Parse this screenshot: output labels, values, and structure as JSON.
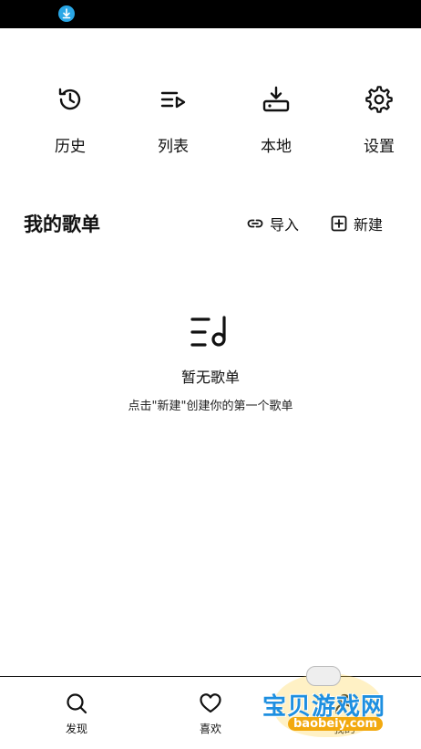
{
  "quick_actions": [
    {
      "label": "历史",
      "icon": "history-icon"
    },
    {
      "label": "列表",
      "icon": "playlist-icon"
    },
    {
      "label": "本地",
      "icon": "local-download-icon"
    },
    {
      "label": "设置",
      "icon": "gear-icon"
    }
  ],
  "playlists": {
    "title": "我的歌单",
    "import_label": "导入",
    "new_label": "新建"
  },
  "empty_state": {
    "title": "暂无歌单",
    "hint": "点击\"新建\"创建你的第一个歌单"
  },
  "tabs": [
    {
      "label": "发现",
      "icon": "search-icon"
    },
    {
      "label": "喜欢",
      "icon": "heart-icon"
    },
    {
      "label": "我的",
      "icon": "user-icon"
    }
  ],
  "watermark": {
    "title": "宝贝游戏网",
    "url": "baobeiy.com"
  },
  "colors": {
    "status_bar": "#000000",
    "download_badge": "#2aa7e6",
    "text": "#111111"
  }
}
